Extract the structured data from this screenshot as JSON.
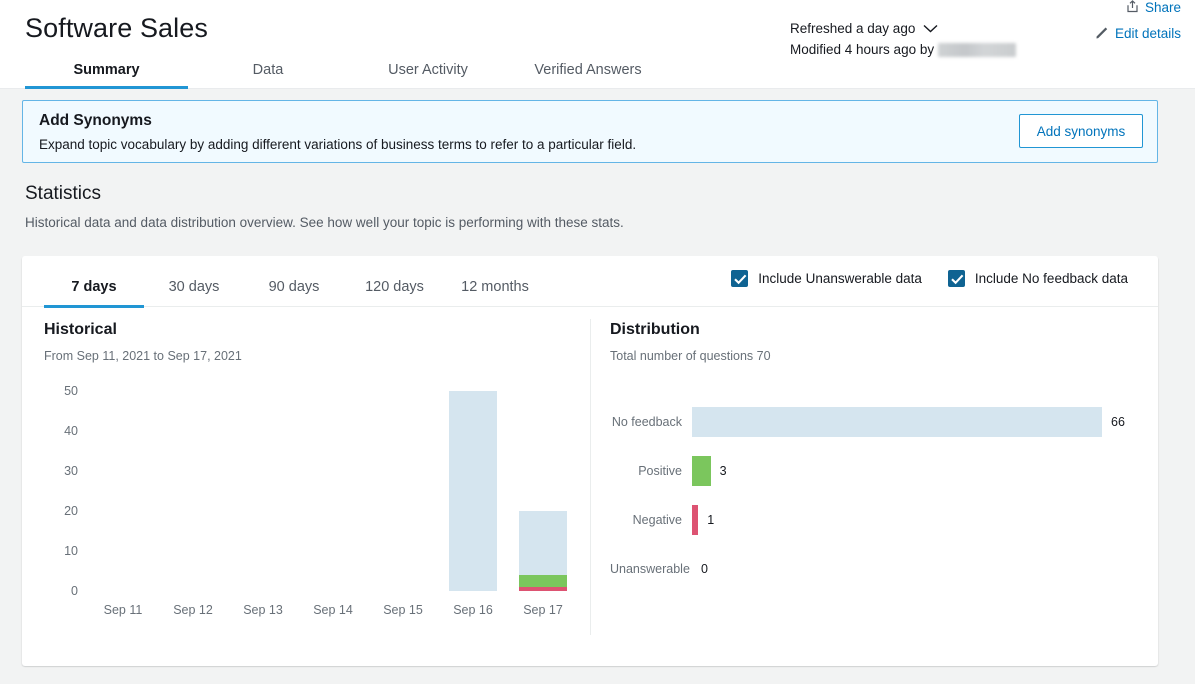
{
  "header": {
    "title": "Software Sales",
    "refreshed_text": "Refreshed a day ago",
    "modified_text": "Modified 4 hours ago by",
    "share_label": "Share",
    "edit_label": "Edit details",
    "share_icon": "share-icon",
    "edit_icon": "pencil-icon",
    "chevron_icon": "chevron-down-icon"
  },
  "top_tabs": [
    {
      "label": "Summary",
      "active": true
    },
    {
      "label": "Data",
      "active": false
    },
    {
      "label": "User Activity",
      "active": false
    },
    {
      "label": "Verified Answers",
      "active": false
    }
  ],
  "banner": {
    "title": "Add Synonyms",
    "description": "Expand topic vocabulary by adding different variations of business terms to refer to a particular field.",
    "button_label": "Add synonyms"
  },
  "statistics": {
    "title": "Statistics",
    "description": "Historical data and data distribution overview. See how well your topic is performing with these stats."
  },
  "range_tabs": [
    {
      "label": "7 days",
      "active": true
    },
    {
      "label": "30 days",
      "active": false
    },
    {
      "label": "90 days",
      "active": false
    },
    {
      "label": "120 days",
      "active": false
    },
    {
      "label": "12 months",
      "active": false
    }
  ],
  "checkboxes": [
    {
      "label": "Include Unanswerable data",
      "checked": true
    },
    {
      "label": "Include No feedback data",
      "checked": true
    }
  ],
  "historical": {
    "title": "Historical",
    "subtitle": "From Sep 11, 2021 to Sep 17, 2021"
  },
  "distribution": {
    "title": "Distribution",
    "subtitle": "Total number of questions 70"
  },
  "colors": {
    "accent": "#2196d4",
    "link": "#0073bb",
    "no_feedback": "#d5e5ef",
    "positive": "#7bc65d",
    "negative": "#dd5372",
    "checkbox": "#0f6392",
    "banner_bg": "#f1faff",
    "banner_border": "#64b5e6",
    "page_bg": "#f2f3f3"
  },
  "chart_data": [
    {
      "type": "bar",
      "title": "Historical",
      "subtitle": "From Sep 11, 2021 to Sep 17, 2021",
      "stacked": true,
      "xlabel": "",
      "ylabel": "",
      "ylim": [
        0,
        50
      ],
      "yticks": [
        0,
        10,
        20,
        30,
        40,
        50
      ],
      "grid": false,
      "legend": "none",
      "categories": [
        "Sep 11",
        "Sep 12",
        "Sep 13",
        "Sep 14",
        "Sep 15",
        "Sep 16",
        "Sep 17"
      ],
      "series": [
        {
          "name": "Negative",
          "color": "#dd5372",
          "values": [
            0,
            0,
            0,
            0,
            0,
            0,
            1
          ]
        },
        {
          "name": "Positive",
          "color": "#7bc65d",
          "values": [
            0,
            0,
            0,
            0,
            0,
            0,
            3
          ]
        },
        {
          "name": "No feedback",
          "color": "#d5e5ef",
          "values": [
            0,
            0,
            0,
            0,
            0,
            50,
            16
          ]
        }
      ],
      "totals": [
        0,
        0,
        0,
        0,
        0,
        50,
        20
      ]
    },
    {
      "type": "bar",
      "orientation": "horizontal",
      "title": "Distribution",
      "subtitle": "Total number of questions 70",
      "xlabel": "",
      "ylabel": "",
      "xlim": [
        0,
        66
      ],
      "grid": false,
      "legend": "none",
      "categories": [
        "No feedback",
        "Positive",
        "Negative",
        "Unanswerable"
      ],
      "values": [
        66,
        3,
        1,
        0
      ],
      "value_labels": [
        "66",
        "3",
        "1",
        "0"
      ],
      "colors": [
        "#d5e5ef",
        "#7bc65d",
        "#dd5372",
        "#d5e5ef"
      ]
    }
  ]
}
